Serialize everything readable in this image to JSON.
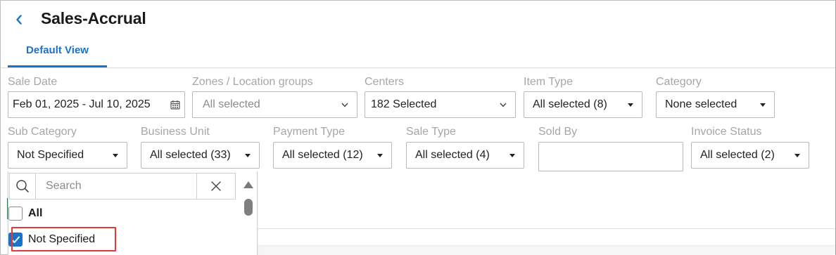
{
  "header": {
    "title": "Sales-Accrual",
    "back_icon": "chevron-left-icon",
    "accent_color": "#1a73c9"
  },
  "tabs": [
    {
      "label": "Default View",
      "active": true
    }
  ],
  "filters": {
    "sale_date": {
      "label": "Sale Date",
      "value": "Feb 01, 2025 - Jul 10, 2025",
      "icon": "calendar-icon"
    },
    "zones": {
      "label": "Zones / Location groups",
      "value": "All selected"
    },
    "centers": {
      "label": "Centers",
      "value": "182 Selected"
    },
    "item_type": {
      "label": "Item Type",
      "value": "All selected (8)"
    },
    "category": {
      "label": "Category",
      "value": "None selected"
    },
    "sub_category": {
      "label": "Sub Category",
      "value": "Not Specified"
    },
    "business_unit": {
      "label": "Business Unit",
      "value": "All selected (33)"
    },
    "payment_type": {
      "label": "Payment Type",
      "value": "All selected (12)"
    },
    "sale_type": {
      "label": "Sale Type",
      "value": "All selected (4)"
    },
    "sold_by": {
      "label": "Sold By",
      "value": ""
    },
    "invoice_status": {
      "label": "Invoice Status",
      "value": "All selected (2)"
    }
  },
  "dropdown": {
    "search_placeholder": "Search",
    "options": [
      {
        "label": "All",
        "checked": false
      },
      {
        "label": "Not Specified",
        "checked": true
      }
    ],
    "highlight_color": "#e53935"
  }
}
